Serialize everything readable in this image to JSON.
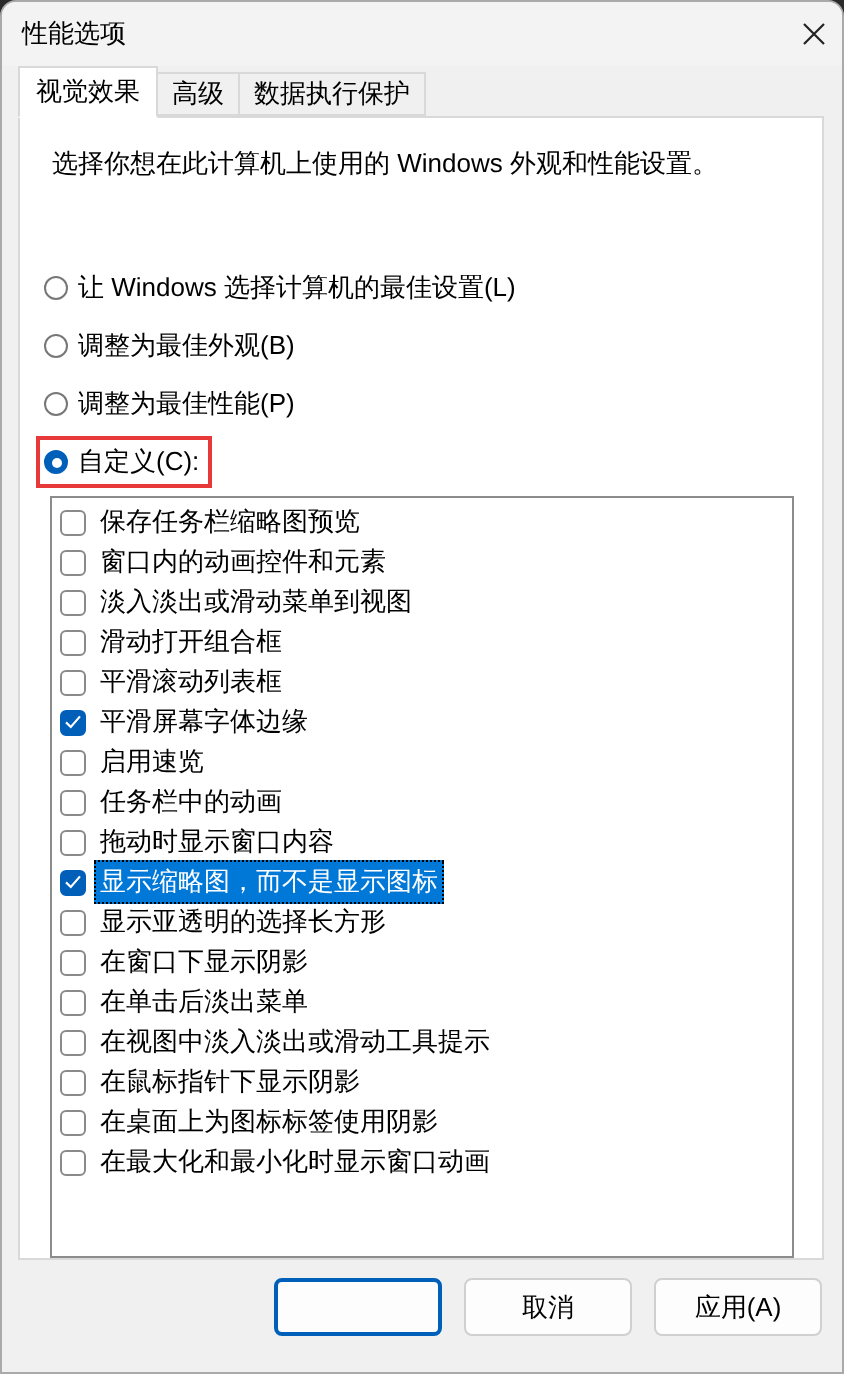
{
  "window": {
    "title": "性能选项"
  },
  "tabs": [
    {
      "label": "视觉效果",
      "selected": true
    },
    {
      "label": "高级",
      "selected": false
    },
    {
      "label": "数据执行保护",
      "selected": false
    }
  ],
  "description": "选择你想在此计算机上使用的 Windows 外观和性能设置。",
  "options": [
    {
      "label": "让 Windows 选择计算机的最佳设置(L)",
      "selected": false,
      "highlighted": false
    },
    {
      "label": "调整为最佳外观(B)",
      "selected": false,
      "highlighted": false
    },
    {
      "label": "调整为最佳性能(P)",
      "selected": false,
      "highlighted": false
    },
    {
      "label": "自定义(C):",
      "selected": true,
      "highlighted": true
    }
  ],
  "items": [
    {
      "label": "保存任务栏缩略图预览",
      "checked": false,
      "selected": false
    },
    {
      "label": "窗口内的动画控件和元素",
      "checked": false,
      "selected": false
    },
    {
      "label": "淡入淡出或滑动菜单到视图",
      "checked": false,
      "selected": false
    },
    {
      "label": "滑动打开组合框",
      "checked": false,
      "selected": false
    },
    {
      "label": "平滑滚动列表框",
      "checked": false,
      "selected": false
    },
    {
      "label": "平滑屏幕字体边缘",
      "checked": true,
      "selected": false
    },
    {
      "label": "启用速览",
      "checked": false,
      "selected": false
    },
    {
      "label": "任务栏中的动画",
      "checked": false,
      "selected": false
    },
    {
      "label": "拖动时显示窗口内容",
      "checked": false,
      "selected": false
    },
    {
      "label": "显示缩略图，而不是显示图标",
      "checked": true,
      "selected": true
    },
    {
      "label": "显示亚透明的选择长方形",
      "checked": false,
      "selected": false
    },
    {
      "label": "在窗口下显示阴影",
      "checked": false,
      "selected": false
    },
    {
      "label": "在单击后淡出菜单",
      "checked": false,
      "selected": false
    },
    {
      "label": "在视图中淡入淡出或滑动工具提示",
      "checked": false,
      "selected": false
    },
    {
      "label": "在鼠标指针下显示阴影",
      "checked": false,
      "selected": false
    },
    {
      "label": "在桌面上为图标标签使用阴影",
      "checked": false,
      "selected": false
    },
    {
      "label": "在最大化和最小化时显示窗口动画",
      "checked": false,
      "selected": false
    }
  ],
  "buttons": [
    {
      "kind": "default"
    },
    {
      "label": "取消",
      "kind": "normal"
    },
    {
      "label": "应用(A)",
      "kind": "normal"
    }
  ]
}
